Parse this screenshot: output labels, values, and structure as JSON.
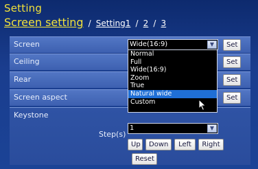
{
  "header": {
    "title": "Setting",
    "subtitle": "Screen setting",
    "sep": "/",
    "page_links": [
      "Setting1",
      "2",
      "3"
    ]
  },
  "rows": {
    "screen": {
      "label": "Screen",
      "value": "Wide(16:9)",
      "set_label": "Set"
    },
    "ceiling": {
      "label": "Ceiling",
      "set_label": "Set"
    },
    "rear": {
      "label": "Rear",
      "set_label": "Set"
    },
    "screen_aspect": {
      "label": "Screen aspect",
      "set_label": "Set"
    },
    "keystone": {
      "label": "Keystone",
      "steps_label": "Step(s)",
      "steps_value": "1",
      "buttons": {
        "up": "Up",
        "down": "Down",
        "left": "Left",
        "right": "Right",
        "reset": "Reset"
      }
    }
  },
  "dropdown": {
    "options": [
      "Normal",
      "Full",
      "Wide(16:9)",
      "Zoom",
      "True",
      "Natural wide",
      "Custom"
    ],
    "highlighted": "Natural wide"
  },
  "colors": {
    "title": "#f2e23a",
    "highlight": "#1f6fd6"
  }
}
